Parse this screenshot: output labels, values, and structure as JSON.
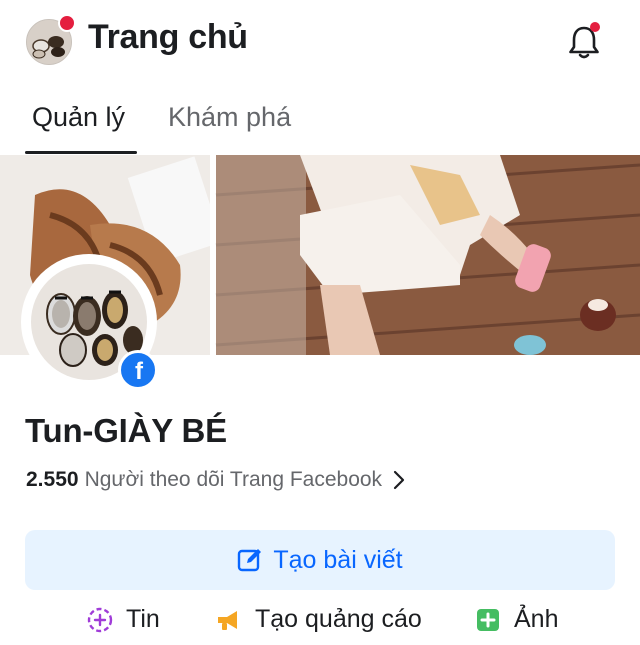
{
  "header": {
    "title": "Trang chủ",
    "avatar_icon": "page-avatar-icon",
    "notifications_icon": "bell-icon",
    "accent_red": "#e41e3f"
  },
  "tabs": [
    {
      "label": "Quản lý",
      "active": true
    },
    {
      "label": "Khám phá",
      "active": false
    }
  ],
  "page": {
    "name": "Tun-GIÀY BÉ",
    "followers_count": "2.550",
    "followers_text": "Người theo dõi Trang Facebook",
    "badge_icon": "facebook-icon"
  },
  "create_post": {
    "label": "Tạo bài viết",
    "icon": "edit-icon",
    "bg": "#e7f3ff",
    "color": "#0866ff"
  },
  "actions": [
    {
      "label": "Tin",
      "icon": "story-plus-icon"
    },
    {
      "label": "Tạo quảng cáo",
      "icon": "megaphone-icon"
    },
    {
      "label": "Ảnh",
      "icon": "photo-add-icon"
    }
  ]
}
